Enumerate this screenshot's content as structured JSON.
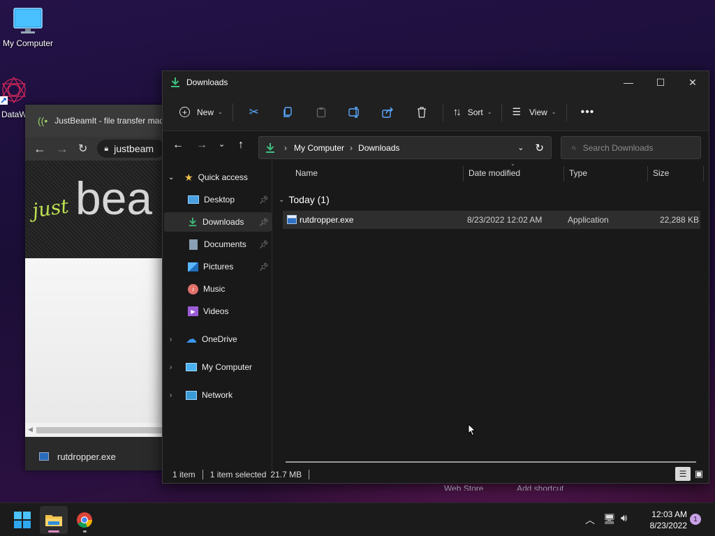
{
  "desktop": {
    "icons": [
      {
        "label": "My Computer",
        "icon": "monitor-icon"
      },
      {
        "label": "DataW",
        "icon": "datawatch-icon"
      }
    ]
  },
  "chrome": {
    "tab_title": "JustBeamIt - file transfer mad",
    "address": "justbeam",
    "hero_text_script": "just",
    "hero_text_big": "bea",
    "download_file": "rutdropper.exe"
  },
  "explorer": {
    "title": "Downloads",
    "toolbar": {
      "new_label": "New",
      "sort_label": "Sort",
      "view_label": "View"
    },
    "address": {
      "crumbs": [
        "My Computer",
        "Downloads"
      ]
    },
    "search": {
      "placeholder": "Search Downloads"
    },
    "nav": {
      "quick_access": "Quick access",
      "items": [
        {
          "label": "Desktop",
          "pinned": true,
          "icon": "desktop-folder-icon"
        },
        {
          "label": "Downloads",
          "pinned": true,
          "icon": "downloads-icon"
        },
        {
          "label": "Documents",
          "pinned": true,
          "icon": "documents-icon"
        },
        {
          "label": "Pictures",
          "pinned": true,
          "icon": "pictures-icon"
        },
        {
          "label": "Music",
          "pinned": false,
          "icon": "music-icon"
        },
        {
          "label": "Videos",
          "pinned": false,
          "icon": "videos-icon"
        }
      ],
      "roots": [
        {
          "label": "OneDrive",
          "icon": "cloud-icon"
        },
        {
          "label": "My Computer",
          "icon": "monitor-icon"
        },
        {
          "label": "Network",
          "icon": "network-icon"
        }
      ]
    },
    "columns": [
      "Name",
      "Date modified",
      "Type",
      "Size"
    ],
    "group_label": "Today (1)",
    "files": [
      {
        "name": "rutdropper.exe",
        "date": "8/23/2022 12:02 AM",
        "type": "Application",
        "size": "22,288 KB"
      }
    ],
    "status": {
      "count": "1 item",
      "selected": "1 item selected",
      "size": "21.7 MB"
    },
    "bg_ghost": {
      "a": "Web Store",
      "b": "Add shortcut"
    }
  },
  "taskbar": {
    "time": "12:03 AM",
    "date": "8/23/2022",
    "notifications": "1"
  },
  "colors": {
    "accent": "#4cc2ff",
    "download_green": "#3fbf7f",
    "folder_yellow": "#f2c14e"
  }
}
